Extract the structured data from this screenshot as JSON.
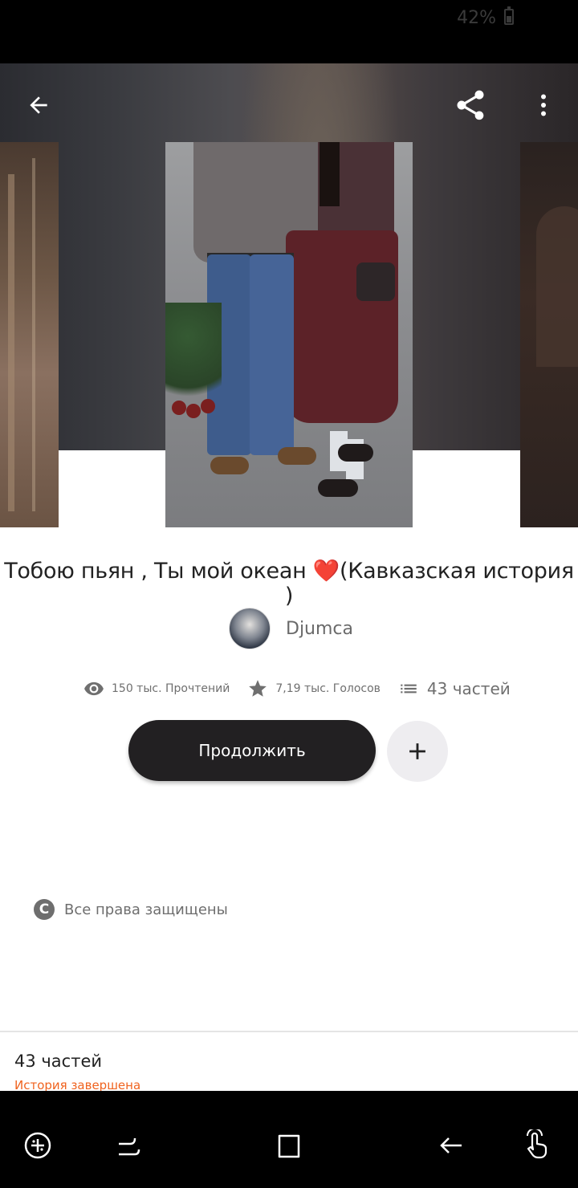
{
  "status_bar": {
    "battery": "42%"
  },
  "toolbar": {
    "back_icon": "arrow-left-icon",
    "share_icon": "share-icon",
    "more_icon": "more-vertical-icon"
  },
  "story": {
    "title": "Тобою пьян , Ты мой океан ",
    "title_emoji": "❤️",
    "title_tail": "(Кавказская история )",
    "author": "Djumca",
    "stats": {
      "reads": "150 тыс. Прочтений",
      "votes": "7,19 тыс. Голосов",
      "parts": "43 частей"
    },
    "continue_label": "Продолжить",
    "add_icon": "plus-icon",
    "copyright": "Все права защищены"
  },
  "footer": {
    "parts_count": "43 частей",
    "status": "История завершена",
    "status_color": "#f0631f"
  },
  "navbar": {
    "items": [
      "game-launcher-icon",
      "recent-apps-icon",
      "home-icon",
      "back-icon",
      "gesture-icon"
    ]
  }
}
